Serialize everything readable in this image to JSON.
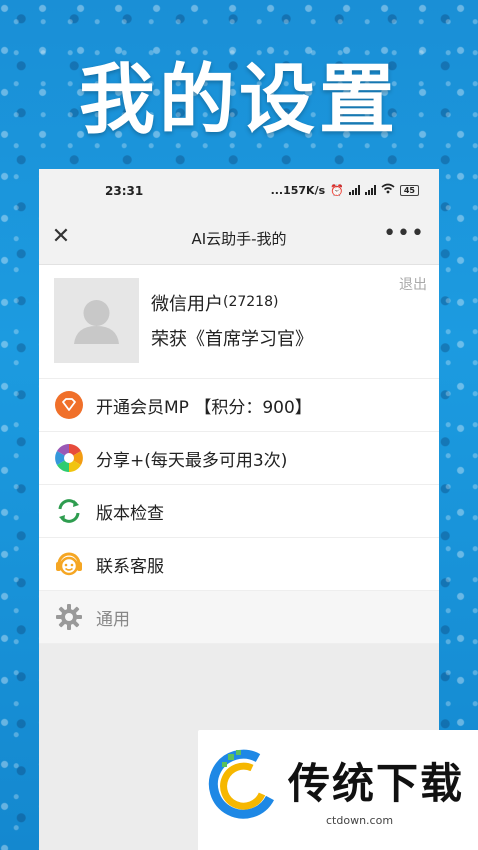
{
  "hero": {
    "title": "我的设置"
  },
  "status_bar": {
    "time": "23:31",
    "network": "...157K/s",
    "battery": "45"
  },
  "nav": {
    "title": "AI云助手-我的",
    "close": "✕",
    "more": "•••"
  },
  "profile": {
    "nickname": "微信用户",
    "user_id": "(27218)",
    "honor": "荣获《首席学习官》",
    "logout_label": "退出"
  },
  "menu": {
    "items": [
      {
        "label": "开通会员MP 【积分：900】",
        "icon": "diamond-icon"
      },
      {
        "label": "分享+(每天最多可用3次)",
        "icon": "share-aperture-icon"
      },
      {
        "label": "版本检查",
        "icon": "refresh-icon"
      },
      {
        "label": "联系客服",
        "icon": "support-agent-icon"
      },
      {
        "label": "通用",
        "icon": "gear-icon"
      }
    ]
  },
  "ad": {
    "brand": "传统下载",
    "url": "ctdown.com"
  },
  "colors": {
    "background_blue": "#1a8fd6",
    "vip_orange": "#f0702a",
    "refresh_green": "#2e9d4f",
    "support_orange": "#f5a623"
  }
}
